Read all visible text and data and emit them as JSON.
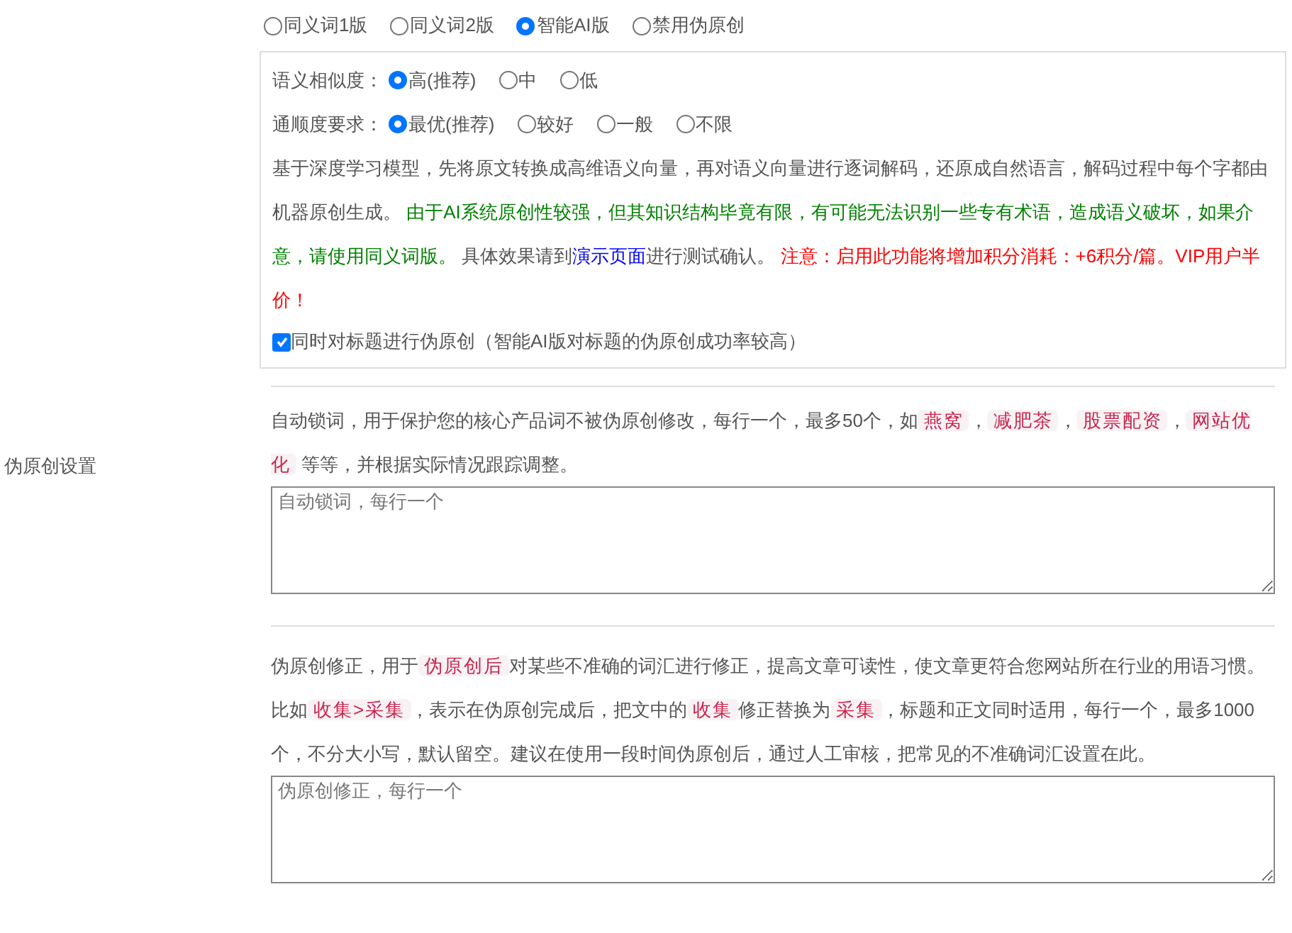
{
  "section_label": "伪原创设置",
  "modes": [
    {
      "label": "同义词1版",
      "selected": false
    },
    {
      "label": "同义词2版",
      "selected": false
    },
    {
      "label": "智能AI版",
      "selected": true
    },
    {
      "label": "禁用伪原创",
      "selected": false
    }
  ],
  "ai_options": [
    {
      "label": "语义相似度：",
      "choices": [
        {
          "label": "高(推荐)",
          "selected": true
        },
        {
          "label": "中",
          "selected": false
        },
        {
          "label": "低",
          "selected": false
        }
      ]
    },
    {
      "label": "通顺度要求：",
      "choices": [
        {
          "label": "最优(推荐)",
          "selected": true
        },
        {
          "label": "较好",
          "selected": false
        },
        {
          "label": "一般",
          "selected": false
        },
        {
          "label": "不限",
          "selected": false
        }
      ]
    }
  ],
  "ai_description": [
    {
      "kind": "text",
      "text": "基于深度学习模型，先将原文转换成高维语义向量，再对语义向量进行逐词解码，还原成自然语言，解码过程中每个字都由机器原创生成。 "
    },
    {
      "kind": "notice",
      "text": "由于AI系统原创性较强，但其知识结构毕竟有限，有可能无法识别一些专有术语，造成语义破坏，如果介意，请使用同义词版。"
    },
    {
      "kind": "text",
      "text": " 具体效果请到"
    },
    {
      "kind": "link",
      "text": "演示页面"
    },
    {
      "kind": "text",
      "text": "进行测试确认。 "
    },
    {
      "kind": "warning",
      "text": "注意：启用此功能将增加积分消耗：+6积分/篇。VIP用户半价！"
    }
  ],
  "title_option": {
    "label": "同时对标题进行伪原创（智能AI版对标题的伪原创成功率较高）",
    "checked": true
  },
  "lock_words": {
    "description": [
      {
        "kind": "text",
        "text": "自动锁词，用于保护您的核心产品词不被伪原创修改，每行一个，最多50个，如"
      },
      {
        "kind": "code",
        "text": "燕窝"
      },
      {
        "kind": "text",
        "text": "，"
      },
      {
        "kind": "code",
        "text": "减肥茶"
      },
      {
        "kind": "text",
        "text": "，"
      },
      {
        "kind": "code",
        "text": "股票配资"
      },
      {
        "kind": "text",
        "text": "，"
      },
      {
        "kind": "code",
        "text": "网站优化"
      },
      {
        "kind": "text",
        "text": " 等等，并根据实际情况跟踪调整。"
      }
    ],
    "placeholder": "自动锁词，每行一个"
  },
  "corrections": {
    "description": [
      {
        "kind": "text",
        "text": "伪原创修正，用于"
      },
      {
        "kind": "code",
        "text": "伪原创后"
      },
      {
        "kind": "text",
        "text": "对某些不准确的词汇进行修正，提高文章可读性，使文章更符合您网站所在行业的用语习惯。比如"
      },
      {
        "kind": "code",
        "text": "收集>采集"
      },
      {
        "kind": "text",
        "text": "，表示在伪原创完成后，把文中的"
      },
      {
        "kind": "code",
        "text": "收集"
      },
      {
        "kind": "text",
        "text": "修正替换为"
      },
      {
        "kind": "code",
        "text": "采集"
      },
      {
        "kind": "text",
        "text": "，标题和正文同时适用，每行一个，最多1000个，不分大小写，默认留空。建议在使用一段时间伪原创后，通过人工审核，把常见的不准确词汇设置在此。"
      }
    ],
    "placeholder": "伪原创修正，每行一个"
  }
}
